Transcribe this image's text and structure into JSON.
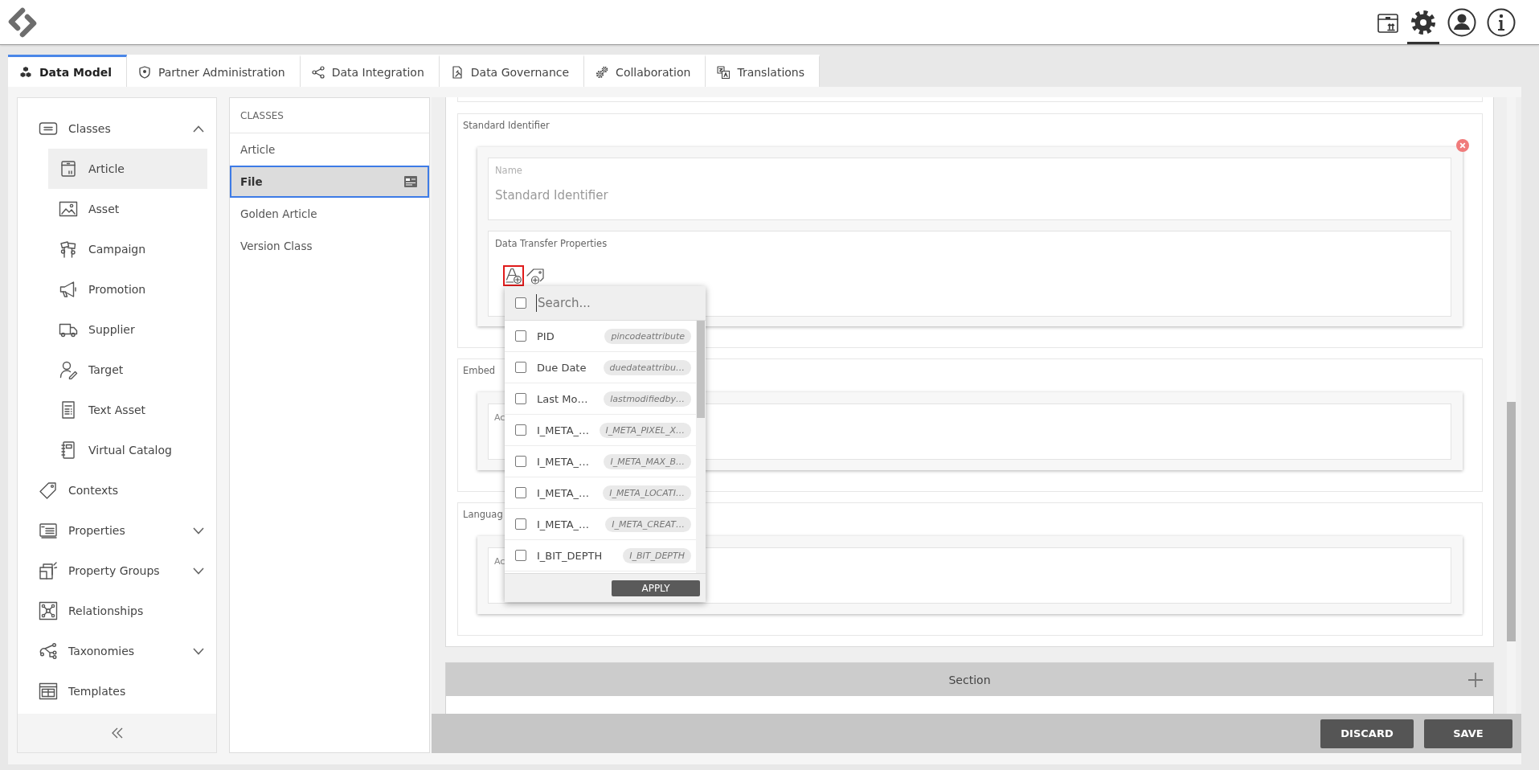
{
  "header": {
    "icons": [
      {
        "selected": false
      },
      {
        "selected": true
      },
      {
        "selected": false
      },
      {
        "selected": false
      }
    ]
  },
  "tabs": [
    {
      "label": "Data Model",
      "selected": true
    },
    {
      "label": "Partner Administration",
      "selected": false
    },
    {
      "label": "Data Integration",
      "selected": false
    },
    {
      "label": "Data Governance",
      "selected": false
    },
    {
      "label": "Collaboration",
      "selected": false
    },
    {
      "label": "Translations",
      "selected": false
    }
  ],
  "sidebar": {
    "items": [
      {
        "label": "Classes",
        "selected": false,
        "expanded": true,
        "children": [
          {
            "label": "Article",
            "selected": true
          },
          {
            "label": "Asset",
            "selected": false
          },
          {
            "label": "Campaign",
            "selected": false
          },
          {
            "label": "Promotion",
            "selected": false
          },
          {
            "label": "Supplier",
            "selected": false
          },
          {
            "label": "Target",
            "selected": false
          },
          {
            "label": "Text Asset",
            "selected": false
          },
          {
            "label": "Virtual Catalog",
            "selected": false
          }
        ]
      },
      {
        "label": "Contexts",
        "selected": false
      },
      {
        "label": "Properties",
        "selected": false,
        "expanded": false
      },
      {
        "label": "Property Groups",
        "selected": false,
        "expanded": false
      },
      {
        "label": "Relationships",
        "selected": false
      },
      {
        "label": "Taxonomies",
        "selected": false,
        "expanded": false
      },
      {
        "label": "Templates",
        "selected": false
      }
    ]
  },
  "class_list": {
    "heading": "CLASSES",
    "items": [
      {
        "label": "Article",
        "selected": false
      },
      {
        "label": "File",
        "selected": true
      },
      {
        "label": "Golden Article",
        "selected": false
      },
      {
        "label": "Version Class",
        "selected": false
      }
    ]
  },
  "editor": {
    "groups": [
      {
        "kind": "identifier",
        "label": "Standard Identifier",
        "name_field": {
          "label": "Name",
          "value": "Standard Identifier"
        },
        "transfer": {
          "label": "Data Transfer Properties",
          "buttons": [
            {
              "active": true
            },
            {
              "active": false
            }
          ]
        },
        "picker": {
          "search_placeholder": "Search...",
          "all_checked": false,
          "items": [
            {
              "label": "PID",
              "tag": "pincodeattribute",
              "checked": false
            },
            {
              "label": "Due Date",
              "tag": "duedateattribu…",
              "checked": false
            },
            {
              "label": "Last Mo…",
              "tag": "lastmodifiedby…",
              "checked": false
            },
            {
              "label": "I_META_…",
              "tag": "I_META_PIXEL_X…",
              "checked": false
            },
            {
              "label": "I_META_…",
              "tag": "I_META_MAX_B…",
              "checked": false
            },
            {
              "label": "I_META_…",
              "tag": "I_META_LOCATI…",
              "checked": false
            },
            {
              "label": "I_META_…",
              "tag": "I_META_CREAT…",
              "checked": false
            },
            {
              "label": "I_BIT_DEPTH",
              "tag": "I_BIT_DEPTH",
              "checked": false
            }
          ],
          "apply": "APPLY"
        }
      },
      {
        "kind": "list",
        "label": "Embed",
        "box_label": "Ac"
      },
      {
        "kind": "list",
        "label": "Languag",
        "box_label": "Ac"
      }
    ],
    "section": {
      "title": "Section"
    },
    "actions": [
      "DISCARD",
      "SAVE"
    ]
  }
}
